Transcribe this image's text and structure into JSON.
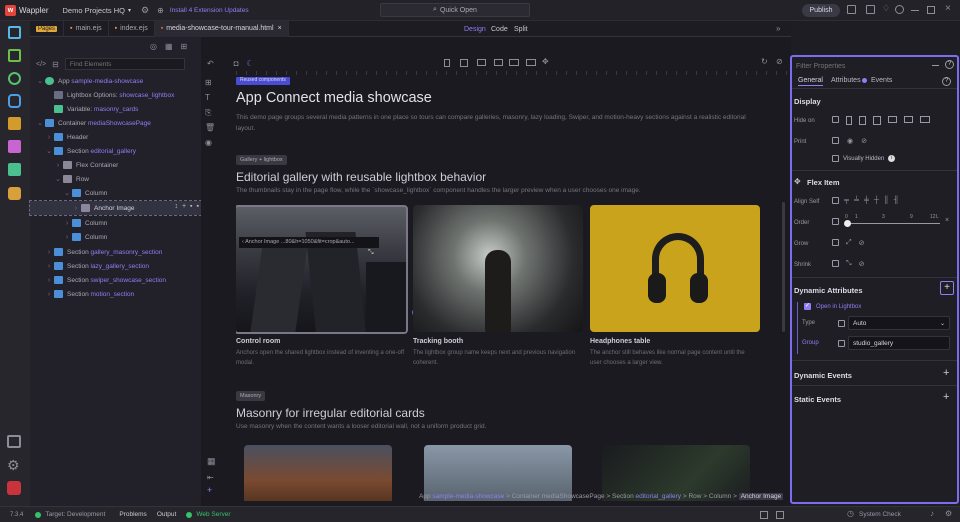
{
  "topbar": {
    "app_name": "Wappler",
    "project": "Demo Projects HQ",
    "update_text": "Install 4 Extension Updates",
    "quick_open": "Quick Open",
    "publish": "Publish"
  },
  "tabs": [
    {
      "label": "Pages"
    },
    {
      "label": "main.ejs"
    },
    {
      "label": "index.ejs"
    },
    {
      "label": "media-showcase-tour-manual.html"
    }
  ],
  "view_modes": {
    "design": "Design",
    "code": "Code",
    "split": "Split"
  },
  "tree": {
    "find_placeholder": "Find Elements",
    "items": [
      {
        "label": "App",
        "detail": "sample-media-showcase"
      },
      {
        "label": "Lightbox Options:",
        "detail": "showcase_lightbox"
      },
      {
        "label": "Variable:",
        "detail": "masonry_cards"
      },
      {
        "label": "Container",
        "detail": "mediaShowcasePage"
      },
      {
        "label": "Header",
        "detail": ""
      },
      {
        "label": "Section",
        "detail": "editorial_gallery"
      },
      {
        "label": "Flex Container",
        "detail": ""
      },
      {
        "label": "Row",
        "detail": ""
      },
      {
        "label": "Column",
        "detail": ""
      },
      {
        "label": "Anchor Image",
        "detail": ""
      },
      {
        "label": "Column",
        "detail": ""
      },
      {
        "label": "Column",
        "detail": ""
      },
      {
        "label": "Section",
        "detail": "gallery_masonry_section"
      },
      {
        "label": "Section",
        "detail": "lazy_gallery_section"
      },
      {
        "label": "Section",
        "detail": "swiper_showcase_section"
      },
      {
        "label": "Section",
        "detail": "motion_section"
      }
    ]
  },
  "canvas": {
    "badge1": "Reused components",
    "title": "App Connect media showcase",
    "intro": "This demo page groups several media patterns in one place so tours can compare galleries, masonry, lazy loading, Swiper, and motion-heavy sections against a realistic editorial layout.",
    "badge2": "Gallery + lightbox",
    "h2": "Editorial gallery with reusable lightbox behavior",
    "sub": "The thumbnails stay in the page flow, while the `showcase_lightbox` component handles the larger preview when a user chooses one image.",
    "tooltip": "Anchor Image ...80&h=1050&fit=crop&auto...",
    "cards": [
      {
        "title": "Control room",
        "text": "Anchors open the shared lightbox instead of inventing a one-off modal."
      },
      {
        "title": "Tracking booth",
        "text": "The lightbox group name keeps next and previous navigation coherent."
      },
      {
        "title": "Headphones table",
        "text": "The anchor still behaves like normal page content until the user chooses a larger view."
      }
    ],
    "badge3": "Masonry",
    "h3": "Masonry for irregular editorial cards",
    "sub3": "Use masonry when the content wants a looser editorial wall, not a uniform product grid.",
    "breadcrumb": {
      "app": "App",
      "app_id": "sample-media-showcase",
      "sep": ">",
      "container": "Container",
      "container_id": "mediaShowcasePage",
      "section": "Section",
      "section_id": "editorial_gallery",
      "row": "Row",
      "column": "Column",
      "anchor": "Anchor Image"
    }
  },
  "props": {
    "filter_placeholder": "Filter Properties",
    "tabs": {
      "general": "General",
      "attributes": "Attributes",
      "events": "Events"
    },
    "display": "Display",
    "hide_on": "Hide on",
    "print": "Print",
    "visually_hidden": "Visually Hidden",
    "flex_item": "Flex Item",
    "align_self": "Align Self",
    "order": "Order",
    "order_ticks": [
      "0",
      "1",
      "3",
      "9",
      "12"
    ],
    "order_end": "L",
    "grow": "Grow",
    "shrink": "Shrink",
    "dyn_attrs": "Dynamic Attributes",
    "open_lightbox": "Open in Lightbox",
    "type_label": "Type",
    "type_value": "Auto",
    "group_label": "Group",
    "group_value": "studio_gallery",
    "dyn_events": "Dynamic Events",
    "static_events": "Static Events"
  },
  "status": {
    "version": "7.3.4",
    "target": "Target: Development",
    "problems": "Problems",
    "output": "Output",
    "web_server": "Web Server",
    "system_check": "System Check"
  },
  "colors": {
    "accent": "#7b6cf0",
    "background": "#1b1a20",
    "green": "#36c26b"
  }
}
